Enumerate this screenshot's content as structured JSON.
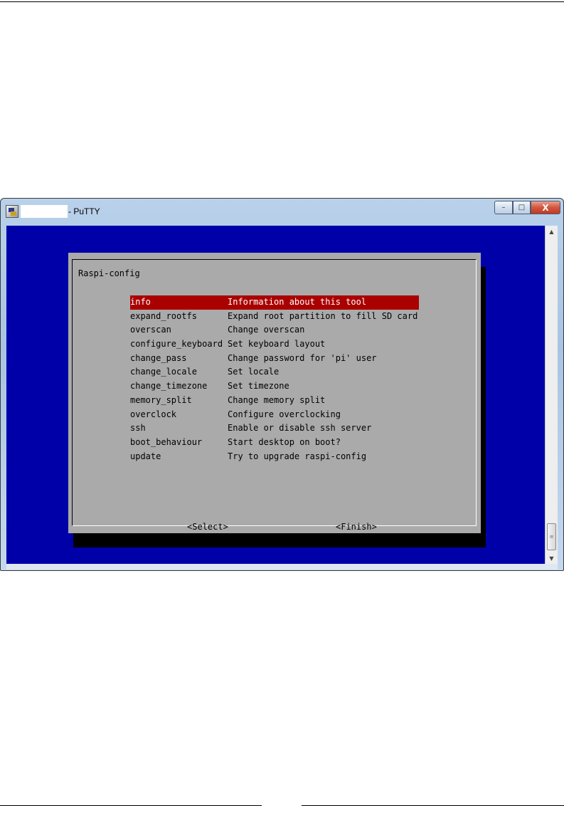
{
  "window": {
    "title": "- PuTTY",
    "controls": {
      "minimize": "–",
      "maximize": "□",
      "close": "X"
    }
  },
  "scrollbar": {
    "up": "▲",
    "down": "▼",
    "grip": "≡"
  },
  "dialog": {
    "title": "Raspi-config",
    "selected_index": 0,
    "items": [
      {
        "key": "info",
        "desc": "Information about this tool"
      },
      {
        "key": "expand_rootfs",
        "desc": "Expand root partition to fill SD card"
      },
      {
        "key": "overscan",
        "desc": "Change overscan"
      },
      {
        "key": "configure_keyboard",
        "desc": "Set keyboard layout"
      },
      {
        "key": "change_pass",
        "desc": "Change password for 'pi' user"
      },
      {
        "key": "change_locale",
        "desc": "Set locale"
      },
      {
        "key": "change_timezone",
        "desc": "Set timezone"
      },
      {
        "key": "memory_split",
        "desc": "Change memory split"
      },
      {
        "key": "overclock",
        "desc": "Configure overclocking"
      },
      {
        "key": "ssh",
        "desc": "Enable or disable ssh server"
      },
      {
        "key": "boot_behaviour",
        "desc": "Start desktop on boot?"
      },
      {
        "key": "update",
        "desc": "Try to upgrade raspi-config"
      }
    ],
    "buttons": {
      "select": "<Select>",
      "finish": "<Finish>"
    }
  },
  "colors": {
    "terminal_bg": "#0000a8",
    "dialog_bg": "#aaaaaa",
    "highlight": "#aa0000"
  }
}
